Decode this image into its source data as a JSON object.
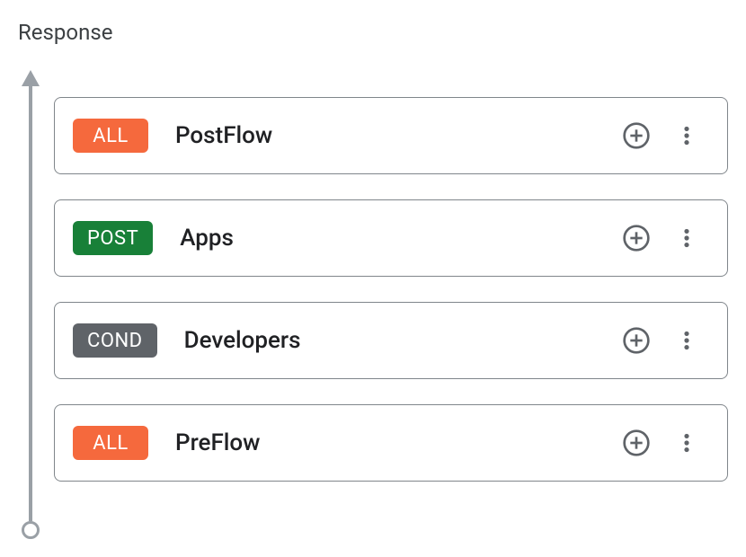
{
  "section": {
    "title": "Response"
  },
  "flows": [
    {
      "tag": "ALL",
      "tag_color": "orange",
      "title": "PostFlow"
    },
    {
      "tag": "POST",
      "tag_color": "green",
      "title": "Apps"
    },
    {
      "tag": "COND",
      "tag_color": "grey",
      "title": "Developers"
    },
    {
      "tag": "ALL",
      "tag_color": "orange",
      "title": "PreFlow"
    }
  ]
}
